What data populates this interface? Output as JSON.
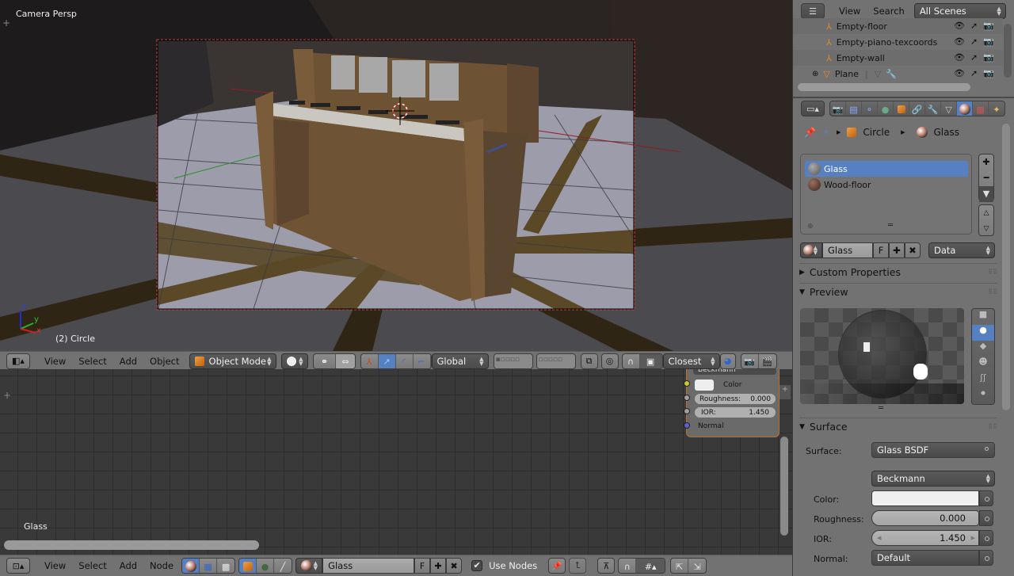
{
  "viewport": {
    "view_label": "Camera Persp",
    "object_label": "(2) Circle",
    "axis_labels": {
      "x": "x",
      "y": "y",
      "z": "z"
    }
  },
  "viewport_header": {
    "editor_type_icon": "3d-view-icon",
    "menus": [
      "View",
      "Select",
      "Add",
      "Object"
    ],
    "mode": "Object Mode",
    "mode_icon": "cube-icon",
    "shading_icon": "solid-sphere-icon",
    "pivot_icon": "pivot-icon",
    "transform_orientation": "Global",
    "snap_element": "Closest",
    "icons": [
      "manipulator-icon",
      "translate-icon",
      "rotate-icon",
      "scale-icon",
      "layers-icon",
      "layer-lock-icon",
      "proportional-edit-icon",
      "snap-magnet-icon",
      "snap-target-icon",
      "render-icon",
      "render-animation-icon"
    ]
  },
  "node_editor": {
    "material_label": "Glass",
    "node": {
      "distribution": "Beckmann",
      "color_label": "Color",
      "roughness_label": "Roughness:",
      "roughness_value": "0.000",
      "ior_label": "IOR:",
      "ior_value": "1.450",
      "normal_label": "Normal"
    }
  },
  "node_header": {
    "editor_type_icon": "node-editor-icon",
    "menus": [
      "View",
      "Select",
      "Add",
      "Node"
    ],
    "material_name": "Glass",
    "fake_user": "F",
    "use_nodes_label": "Use Nodes",
    "use_nodes_checked": true
  },
  "outliner": {
    "header": {
      "menus": [
        "View",
        "Search"
      ],
      "display_mode": "All Scenes"
    },
    "items": [
      {
        "name": "Empty-floor",
        "icon": "empty-icon"
      },
      {
        "name": "Empty-piano-texcoords",
        "icon": "empty-icon"
      },
      {
        "name": "Empty-wall",
        "icon": "empty-icon"
      },
      {
        "name": "Plane",
        "icon": "mesh-icon",
        "extra_icons": [
          "vertex-group-icon",
          "wrench-icon"
        ]
      }
    ]
  },
  "properties": {
    "tabs": [
      "render-icon",
      "render-layers-icon",
      "scene-icon",
      "world-icon",
      "object-icon",
      "constraints-icon",
      "modifiers-icon",
      "data-icon",
      "material-icon",
      "texture-icon",
      "particles-icon"
    ],
    "active_tab": "material-icon",
    "breadcrumb": [
      "Circle",
      "Glass"
    ],
    "material_slots": [
      {
        "name": "Glass",
        "selected": true
      },
      {
        "name": "Wood-floor",
        "selected": false
      }
    ],
    "material_name": "Glass",
    "fake_user": "F",
    "link": "Data",
    "panels": {
      "custom_properties": "Custom Properties",
      "preview": "Preview",
      "surface": "Surface"
    },
    "surface": {
      "surface_label": "Surface:",
      "surface_value": "Glass BSDF",
      "distribution": "Beckmann",
      "color_label": "Color:",
      "color_value": "#f0f0f0",
      "roughness_label": "Roughness:",
      "roughness_value": "0.000",
      "ior_label": "IOR:",
      "ior_value": "1.450",
      "normal_label": "Normal:",
      "normal_value": "Default"
    }
  }
}
